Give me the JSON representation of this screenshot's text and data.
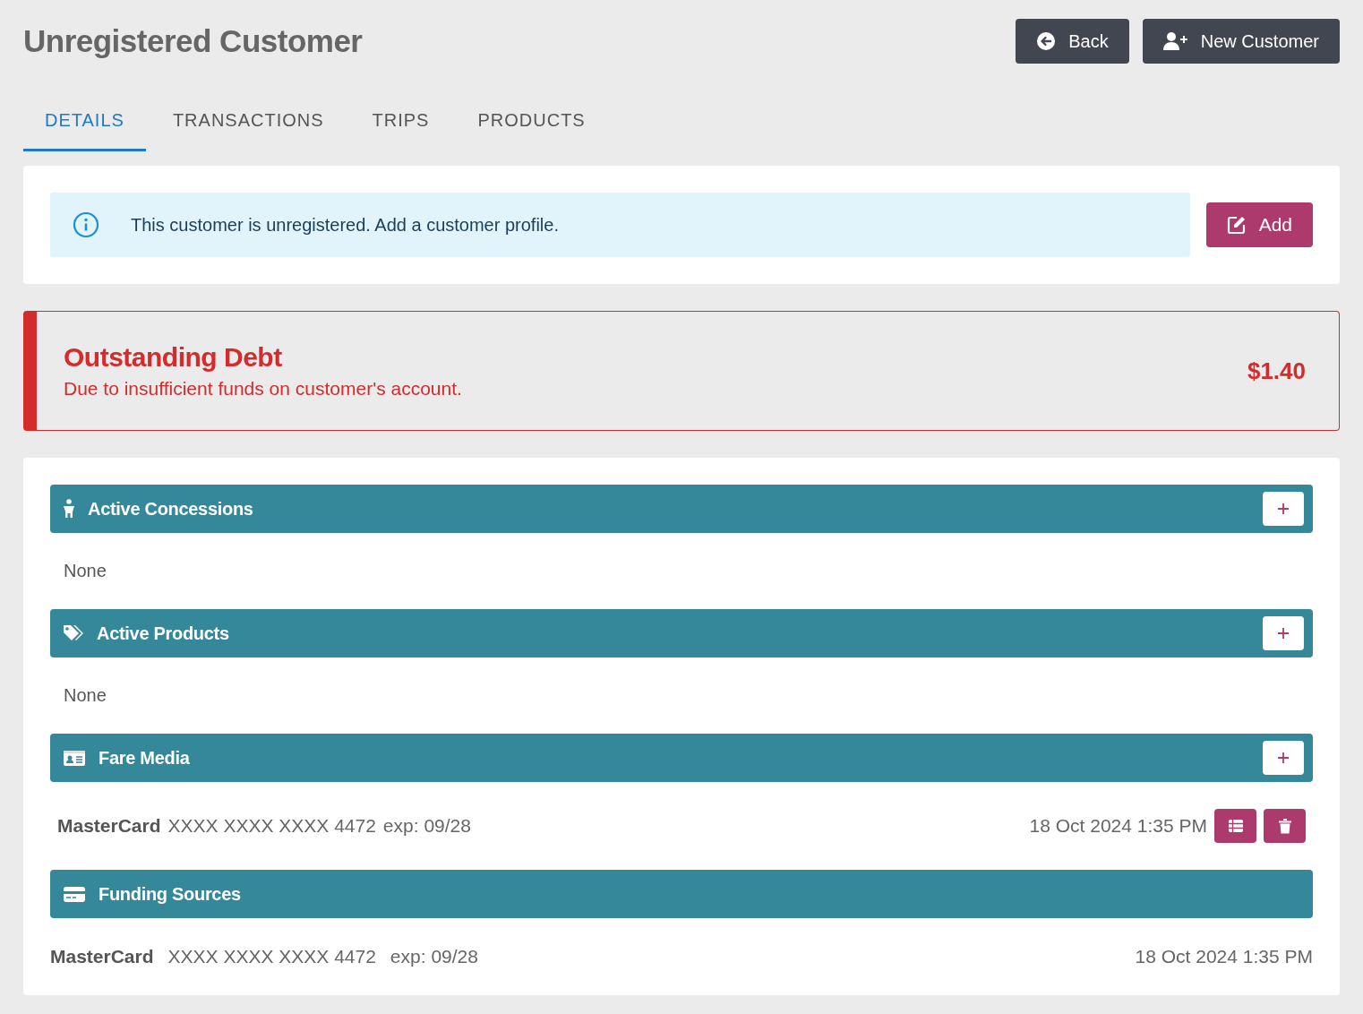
{
  "page": {
    "title": "Unregistered Customer",
    "buttons": [
      {
        "label": "Back",
        "kind": "back"
      },
      {
        "label": "New Customer",
        "kind": "new-customer"
      }
    ]
  },
  "tabs": [
    {
      "label": "DETAILS",
      "selected": true
    },
    {
      "label": "TRANSACTIONS",
      "selected": false
    },
    {
      "label": "TRIPS",
      "selected": false
    },
    {
      "label": "PRODUCTS",
      "selected": false
    }
  ],
  "notice": {
    "text": "This customer is unregistered. Add a customer profile.",
    "button": "Add"
  },
  "debt": {
    "title": "Outstanding Debt",
    "description": "Due to insufficient funds on customer's account.",
    "amount": "$1.40"
  },
  "sections": [
    {
      "kind": "concessions",
      "title": "Active Concessions",
      "add_button": true,
      "empty_text": "None"
    },
    {
      "kind": "products",
      "title": "Active Products",
      "add_button": true,
      "empty_text": "None"
    },
    {
      "kind": "fare-media",
      "title": "Fare Media",
      "add_button": true,
      "items": [
        {
          "brand": "MasterCard",
          "number": "XXXX XXXX XXXX 4472",
          "expiry": "exp: 09/28",
          "date": "18 Oct 2024 1:35 PM",
          "actions": [
            {
              "kind": "details"
            },
            {
              "kind": "delete"
            }
          ]
        }
      ]
    },
    {
      "kind": "funding",
      "title": "Funding Sources",
      "add_button": false,
      "items": [
        {
          "brand": "MasterCard",
          "number": "XXXX XXXX XXXX 4472",
          "expiry": "exp: 09/28",
          "date": "18 Oct 2024 1:35 PM"
        }
      ]
    }
  ]
}
